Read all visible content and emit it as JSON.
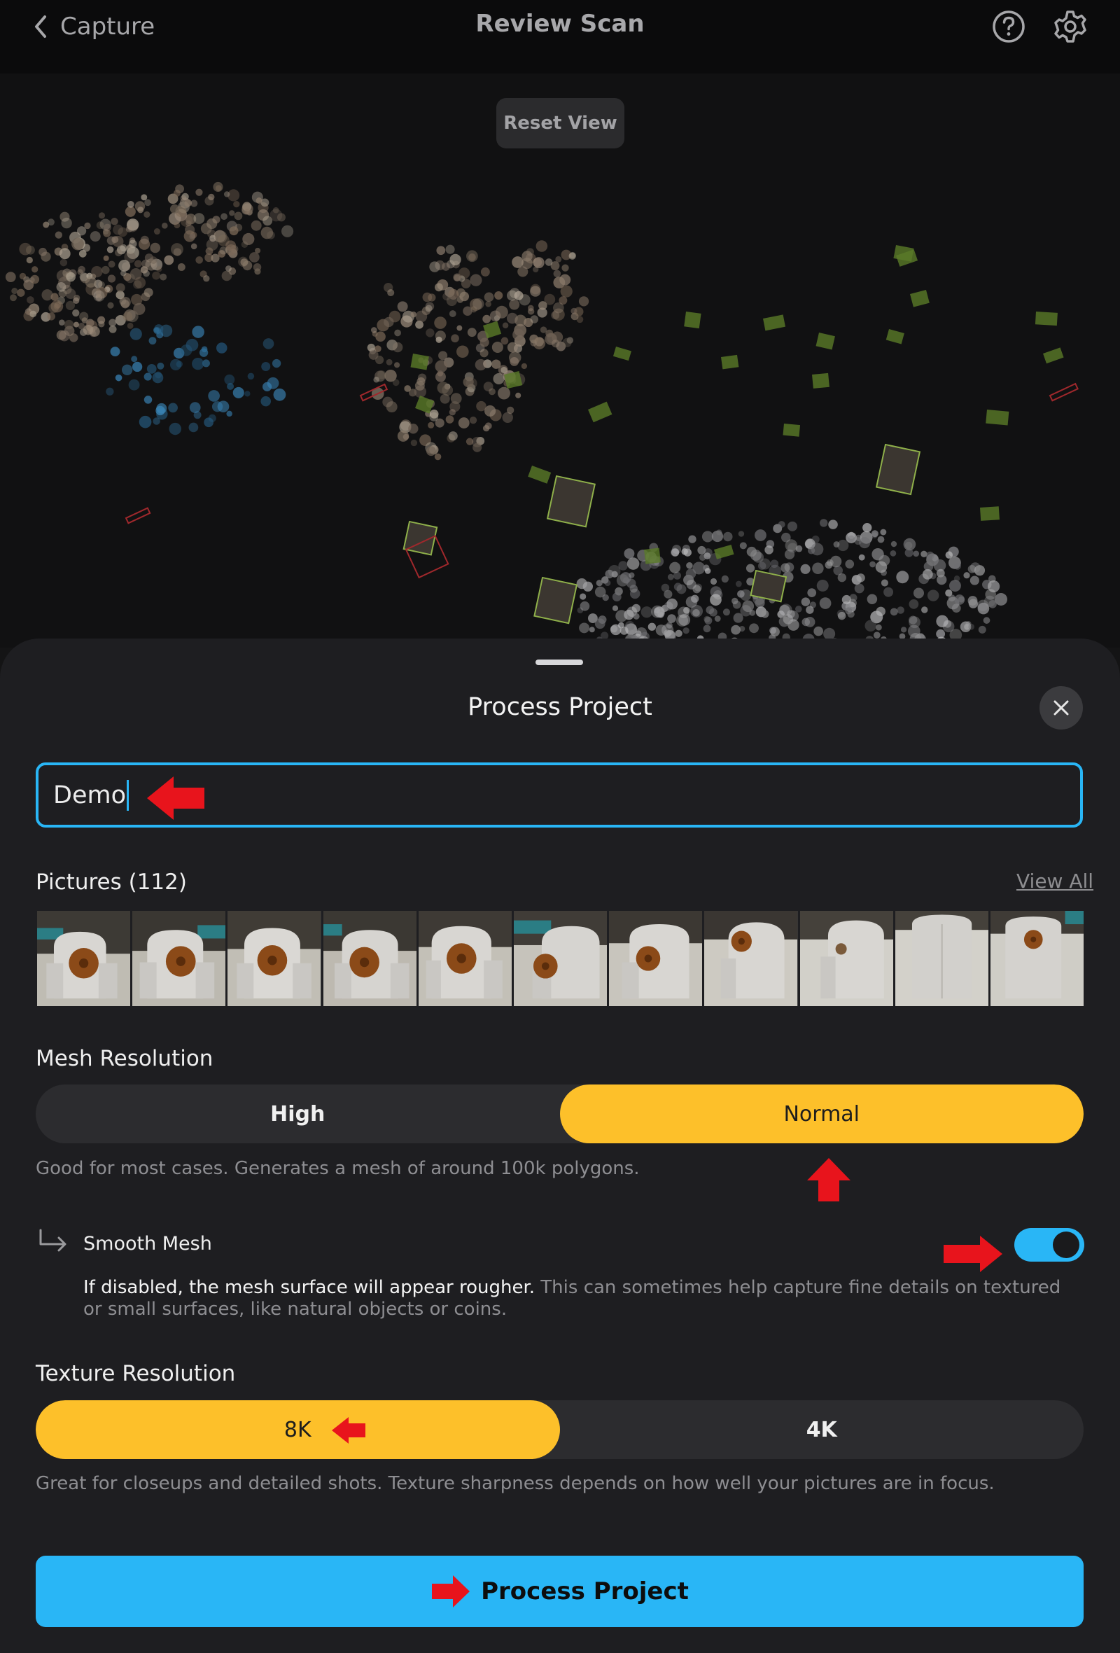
{
  "nav": {
    "back_label": "Capture",
    "title": "Review Scan",
    "help_icon": "question-circle-icon",
    "settings_icon": "gear-icon"
  },
  "viewport": {
    "reset_label": "Reset View"
  },
  "sheet": {
    "title": "Process Project",
    "close_icon": "close-icon",
    "project_name": "Demo",
    "pictures_label": "Pictures (112)",
    "view_all_label": "View All",
    "mesh_resolution": {
      "label": "Mesh Resolution",
      "options": [
        "High",
        "Normal"
      ],
      "selected": "Normal",
      "help": "Good for most cases. Generates a mesh of around 100k polygons."
    },
    "smooth_mesh": {
      "label": "Smooth Mesh",
      "enabled": true,
      "desc_strong": "If disabled, the mesh surface will appear rougher.",
      "desc_rest": " This can sometimes help capture fine details on textured or small surfaces, like natural objects or coins."
    },
    "texture_resolution": {
      "label": "Texture Resolution",
      "options": [
        "8K",
        "4K"
      ],
      "selected": "8K",
      "help": "Great for closeups and detailed shots. Texture sharpness depends on how well your pictures are in focus."
    },
    "process_label": "Process Project"
  },
  "colors": {
    "accent_blue": "#29B6F6",
    "accent_yellow": "#FDC02A",
    "annotation_red": "#E8141C",
    "sheet_bg": "#1E1E21"
  }
}
